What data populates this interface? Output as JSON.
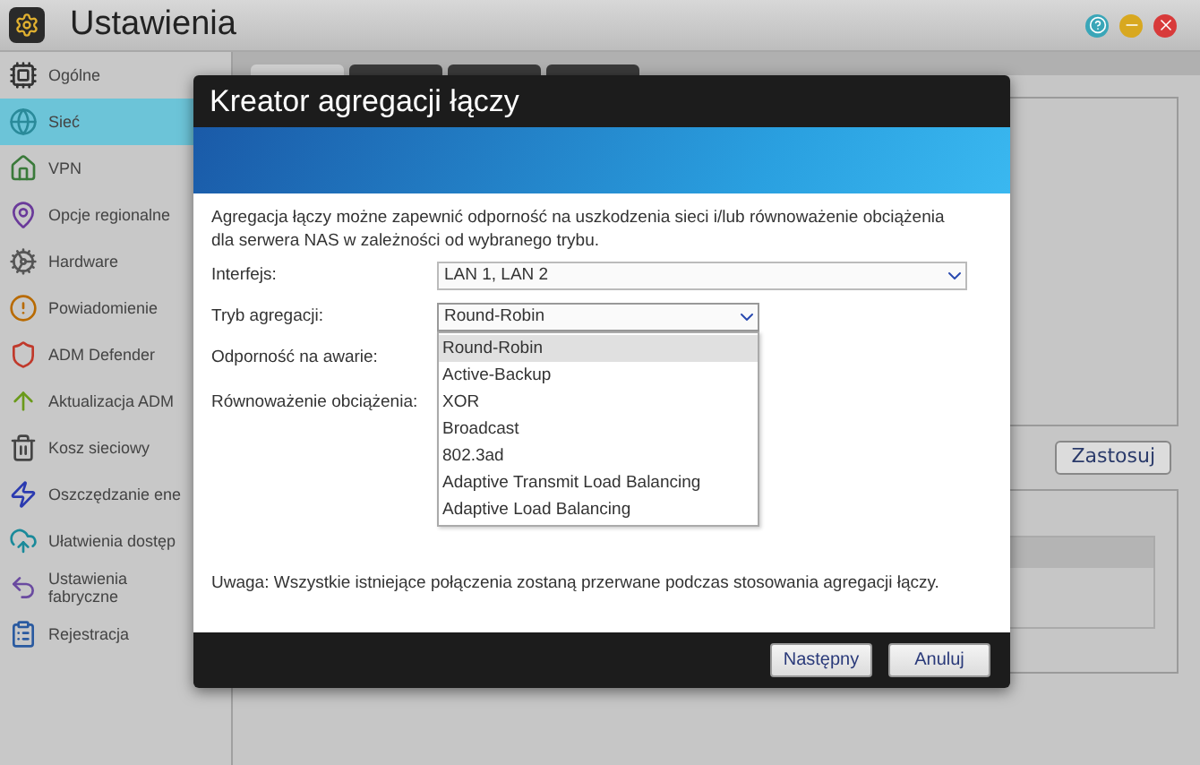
{
  "window": {
    "title": "Ustawienia"
  },
  "sidebar": {
    "items": [
      {
        "label": "Ogólne",
        "selected": false
      },
      {
        "label": "Sieć",
        "selected": true
      },
      {
        "label": "VPN",
        "selected": false
      },
      {
        "label": "Opcje regionalne",
        "selected": false
      },
      {
        "label": "Hardware",
        "selected": false
      },
      {
        "label": "Powiadomienie",
        "selected": false
      },
      {
        "label": "ADM Defender",
        "selected": false
      },
      {
        "label": "Aktualizacja ADM",
        "selected": false
      },
      {
        "label": "Kosz sieciowy",
        "selected": false
      },
      {
        "label": "Oszczędzanie ene",
        "selected": false
      },
      {
        "label": "Ułatwienia dostęp",
        "selected": false
      },
      {
        "label": "Ustawienia fabryczne",
        "selected": false
      },
      {
        "label": "Rejestracja",
        "selected": false
      }
    ]
  },
  "tabs": [
    {
      "selected": true
    },
    {
      "selected": false
    },
    {
      "selected": false
    },
    {
      "selected": false
    }
  ],
  "apply_button": "Zastosuj",
  "dialog": {
    "title": "Kreator agregacji łączy",
    "description": "Agregacja łączy możne zapewnić odporność na uszkodzenia sieci i/lub równoważenie obciążenia dla serwera NAS w zależności od wybranego trybu.",
    "interface": {
      "label": "Interfejs:",
      "value": "LAN 1, LAN 2"
    },
    "mode": {
      "label": "Tryb agregacji:",
      "value": "Round-Robin",
      "expanded": true,
      "options": [
        {
          "label": "Round-Robin",
          "selected": true
        },
        {
          "label": "Active-Backup",
          "selected": false
        },
        {
          "label": "XOR",
          "selected": false
        },
        {
          "label": "Broadcast",
          "selected": false
        },
        {
          "label": "802.3ad",
          "selected": false
        },
        {
          "label": "Adaptive Transmit Load Balancing",
          "selected": false
        },
        {
          "label": "Adaptive Load Balancing",
          "selected": false
        }
      ]
    },
    "fault_tolerance": {
      "label": "Odporność na awarie:"
    },
    "load_balancing": {
      "label": "Równoważenie obciążenia:"
    },
    "note": "Uwaga: Wszystkie istniejące połączenia zostaną przerwane podczas stosowania agregacji łączy.",
    "buttons": [
      "Następny",
      "Anuluj"
    ]
  }
}
